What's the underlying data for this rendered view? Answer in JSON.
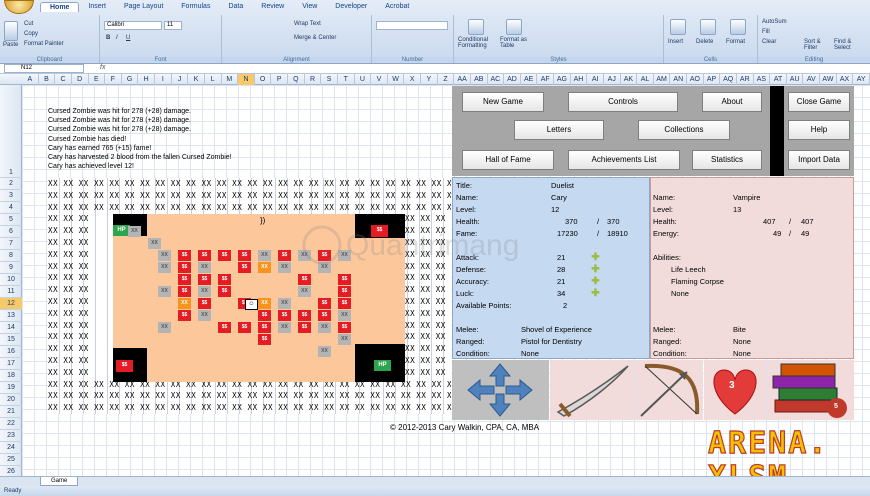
{
  "ribbon": {
    "tabs": [
      "Home",
      "Insert",
      "Page Layout",
      "Formulas",
      "Data",
      "Review",
      "View",
      "Developer",
      "Acrobat"
    ],
    "active_tab": "Home",
    "clipboard": {
      "paste": "Paste",
      "cut": "Cut",
      "copy": "Copy",
      "format_painter": "Format Painter",
      "label": "Clipboard"
    },
    "font": {
      "name": "Calibri",
      "size": "11",
      "label": "Font"
    },
    "alignment": {
      "wrap": "Wrap Text",
      "merge": "Merge & Center",
      "label": "Alignment"
    },
    "number": {
      "label": "Number"
    },
    "styles": {
      "conditional": "Conditional Formatting",
      "format_table": "Format as Table",
      "label": "Styles"
    },
    "cells": {
      "insert": "Insert",
      "delete": "Delete",
      "format": "Format",
      "label": "Cells"
    },
    "editing": {
      "autosum": "AutoSum",
      "fill": "Fill",
      "clear": "Clear",
      "sort": "Sort & Filter",
      "find": "Find & Select",
      "label": "Editing"
    }
  },
  "formula_bar": {
    "name_box": "N12",
    "fx": "fx"
  },
  "columns": [
    "A",
    "B",
    "C",
    "D",
    "E",
    "F",
    "G",
    "H",
    "I",
    "J",
    "K",
    "L",
    "M",
    "N",
    "O",
    "P",
    "Q",
    "R",
    "S",
    "T",
    "U",
    "V",
    "W",
    "X",
    "Y",
    "Z",
    "AA",
    "AB",
    "AC",
    "AD",
    "AE",
    "AF",
    "AG",
    "AH",
    "AI",
    "AJ",
    "AK",
    "AL",
    "AM",
    "AN",
    "AO",
    "AP",
    "AQ",
    "AR",
    "AS",
    "AT",
    "AU",
    "AV",
    "AW",
    "AX",
    "AY"
  ],
  "selected_column": "N",
  "rows": [
    "1",
    "2",
    "3",
    "4",
    "5",
    "6",
    "7",
    "8",
    "9",
    "10",
    "11",
    "12",
    "13",
    "14",
    "15",
    "16",
    "17",
    "18",
    "19",
    "20",
    "21",
    "22",
    "23",
    "24",
    "25",
    "26"
  ],
  "selected_row": "12",
  "log": [
    "Cursed Zombie was hit for 278 (+28) damage.",
    "Cursed Zombie was hit for 278 (+28) damage.",
    "Cursed Zombie was hit for 278 (+28) damage.",
    "Cursed Zombie has died!",
    "Cary has earned 765 (+15) fame!",
    "Cary has harvested 2 blood from the fallen Cursed Zombie!",
    "Cary has achieved level 12!"
  ],
  "map": {
    "wall_row": "XX XX XX XX XX XX XX XX XX XX XX XX XX XX XX XX XX XX XX XX XX XX XX XX XX XX XX XX XX XX XX XX XX",
    "wall_side": "XX XX XX",
    "hp_label": "HP",
    "money_label": "$$",
    "trap_label": "XX",
    "player_glyph": "☺",
    "enemy_glyph": "})"
  },
  "buttons": {
    "new_game": "New Game",
    "controls": "Controls",
    "about": "About",
    "close_game": "Close Game",
    "letters": "Letters",
    "collections": "Collections",
    "help": "Help",
    "hall_of_fame": "Hall of Fame",
    "achievements": "Achievements List",
    "statistics": "Statistics",
    "import_data": "Import Data"
  },
  "player": {
    "title_label": "Title:",
    "title": "Duelist",
    "name_label": "Name:",
    "name": "Cary",
    "level_label": "Level:",
    "level": "12",
    "health_label": "Health:",
    "health": "370",
    "health_max": "370",
    "fame_label": "Fame:",
    "fame": "17230",
    "fame_max": "18910",
    "attack_label": "Attack:",
    "attack": "21",
    "defense_label": "Defense:",
    "defense": "28",
    "accuracy_label": "Accuracy:",
    "accuracy": "21",
    "luck_label": "Luck:",
    "luck": "34",
    "points_label": "Available Points:",
    "points": "2",
    "melee_label": "Melee:",
    "melee": "Shovel of Experience",
    "ranged_label": "Ranged:",
    "ranged": "Pistol for Dentistry",
    "condition_label": "Condition:",
    "condition": "None",
    "slash": "/"
  },
  "enemy": {
    "name_label": "Name:",
    "name": "Vampire",
    "level_label": "Level:",
    "level": "13",
    "health_label": "Health:",
    "health": "407",
    "health_max": "407",
    "energy_label": "Energy:",
    "energy": "49",
    "energy_max": "49",
    "abilities_label": "Abilities:",
    "abilities": [
      "Life Leech",
      "Flaming Corpse",
      "None"
    ],
    "melee_label": "Melee:",
    "melee": "Bite",
    "ranged_label": "Ranged:",
    "ranged": "None",
    "condition_label": "Condition:",
    "condition": "None",
    "slash": "/"
  },
  "actions": {
    "heart_count": "3",
    "books_count": "5"
  },
  "copyright": "© 2012-2013 Cary Walkin, CPA, CA, MBA",
  "logo": {
    "line1": "ARENA.",
    "line2": "XLSM"
  },
  "watermark": "Quantrimang",
  "sheet_tab": "Game",
  "status": "Ready",
  "colors": {
    "player_panel": "#c5d9f1",
    "enemy_panel": "#f2dcdb",
    "arena_floor": "#fdc79c",
    "hp_green": "#2da44e",
    "money_red": "#e51c23",
    "trap_gray": "#b4b4b4",
    "logo_yellow": "#f2c200",
    "logo_red": "#c0392b"
  }
}
